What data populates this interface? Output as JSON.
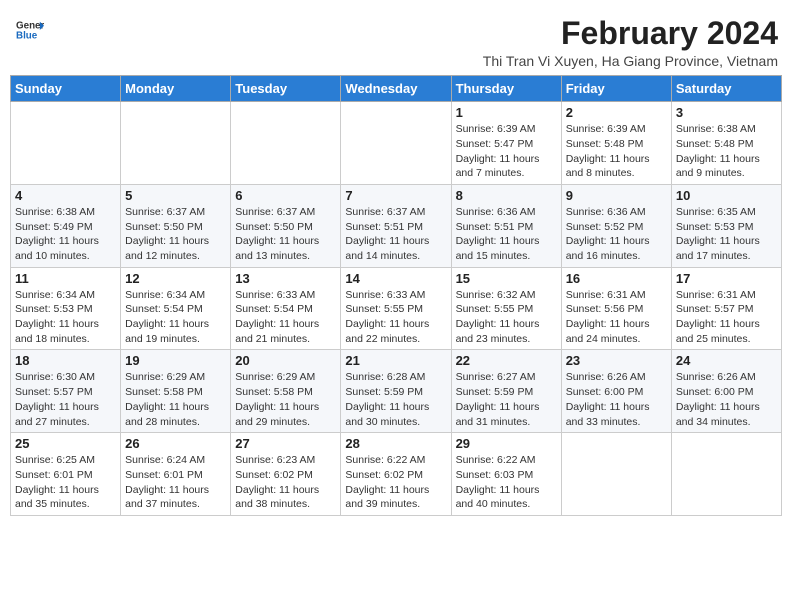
{
  "header": {
    "logo_general": "General",
    "logo_blue": "Blue",
    "month_year": "February 2024",
    "location": "Thi Tran Vi Xuyen, Ha Giang Province, Vietnam"
  },
  "weekdays": [
    "Sunday",
    "Monday",
    "Tuesday",
    "Wednesday",
    "Thursday",
    "Friday",
    "Saturday"
  ],
  "weeks": [
    [
      {
        "day": "",
        "info": ""
      },
      {
        "day": "",
        "info": ""
      },
      {
        "day": "",
        "info": ""
      },
      {
        "day": "",
        "info": ""
      },
      {
        "day": "1",
        "info": "Sunrise: 6:39 AM\nSunset: 5:47 PM\nDaylight: 11 hours and 7 minutes."
      },
      {
        "day": "2",
        "info": "Sunrise: 6:39 AM\nSunset: 5:48 PM\nDaylight: 11 hours and 8 minutes."
      },
      {
        "day": "3",
        "info": "Sunrise: 6:38 AM\nSunset: 5:48 PM\nDaylight: 11 hours and 9 minutes."
      }
    ],
    [
      {
        "day": "4",
        "info": "Sunrise: 6:38 AM\nSunset: 5:49 PM\nDaylight: 11 hours and 10 minutes."
      },
      {
        "day": "5",
        "info": "Sunrise: 6:37 AM\nSunset: 5:50 PM\nDaylight: 11 hours and 12 minutes."
      },
      {
        "day": "6",
        "info": "Sunrise: 6:37 AM\nSunset: 5:50 PM\nDaylight: 11 hours and 13 minutes."
      },
      {
        "day": "7",
        "info": "Sunrise: 6:37 AM\nSunset: 5:51 PM\nDaylight: 11 hours and 14 minutes."
      },
      {
        "day": "8",
        "info": "Sunrise: 6:36 AM\nSunset: 5:51 PM\nDaylight: 11 hours and 15 minutes."
      },
      {
        "day": "9",
        "info": "Sunrise: 6:36 AM\nSunset: 5:52 PM\nDaylight: 11 hours and 16 minutes."
      },
      {
        "day": "10",
        "info": "Sunrise: 6:35 AM\nSunset: 5:53 PM\nDaylight: 11 hours and 17 minutes."
      }
    ],
    [
      {
        "day": "11",
        "info": "Sunrise: 6:34 AM\nSunset: 5:53 PM\nDaylight: 11 hours and 18 minutes."
      },
      {
        "day": "12",
        "info": "Sunrise: 6:34 AM\nSunset: 5:54 PM\nDaylight: 11 hours and 19 minutes."
      },
      {
        "day": "13",
        "info": "Sunrise: 6:33 AM\nSunset: 5:54 PM\nDaylight: 11 hours and 21 minutes."
      },
      {
        "day": "14",
        "info": "Sunrise: 6:33 AM\nSunset: 5:55 PM\nDaylight: 11 hours and 22 minutes."
      },
      {
        "day": "15",
        "info": "Sunrise: 6:32 AM\nSunset: 5:55 PM\nDaylight: 11 hours and 23 minutes."
      },
      {
        "day": "16",
        "info": "Sunrise: 6:31 AM\nSunset: 5:56 PM\nDaylight: 11 hours and 24 minutes."
      },
      {
        "day": "17",
        "info": "Sunrise: 6:31 AM\nSunset: 5:57 PM\nDaylight: 11 hours and 25 minutes."
      }
    ],
    [
      {
        "day": "18",
        "info": "Sunrise: 6:30 AM\nSunset: 5:57 PM\nDaylight: 11 hours and 27 minutes."
      },
      {
        "day": "19",
        "info": "Sunrise: 6:29 AM\nSunset: 5:58 PM\nDaylight: 11 hours and 28 minutes."
      },
      {
        "day": "20",
        "info": "Sunrise: 6:29 AM\nSunset: 5:58 PM\nDaylight: 11 hours and 29 minutes."
      },
      {
        "day": "21",
        "info": "Sunrise: 6:28 AM\nSunset: 5:59 PM\nDaylight: 11 hours and 30 minutes."
      },
      {
        "day": "22",
        "info": "Sunrise: 6:27 AM\nSunset: 5:59 PM\nDaylight: 11 hours and 31 minutes."
      },
      {
        "day": "23",
        "info": "Sunrise: 6:26 AM\nSunset: 6:00 PM\nDaylight: 11 hours and 33 minutes."
      },
      {
        "day": "24",
        "info": "Sunrise: 6:26 AM\nSunset: 6:00 PM\nDaylight: 11 hours and 34 minutes."
      }
    ],
    [
      {
        "day": "25",
        "info": "Sunrise: 6:25 AM\nSunset: 6:01 PM\nDaylight: 11 hours and 35 minutes."
      },
      {
        "day": "26",
        "info": "Sunrise: 6:24 AM\nSunset: 6:01 PM\nDaylight: 11 hours and 37 minutes."
      },
      {
        "day": "27",
        "info": "Sunrise: 6:23 AM\nSunset: 6:02 PM\nDaylight: 11 hours and 38 minutes."
      },
      {
        "day": "28",
        "info": "Sunrise: 6:22 AM\nSunset: 6:02 PM\nDaylight: 11 hours and 39 minutes."
      },
      {
        "day": "29",
        "info": "Sunrise: 6:22 AM\nSunset: 6:03 PM\nDaylight: 11 hours and 40 minutes."
      },
      {
        "day": "",
        "info": ""
      },
      {
        "day": "",
        "info": ""
      }
    ]
  ]
}
